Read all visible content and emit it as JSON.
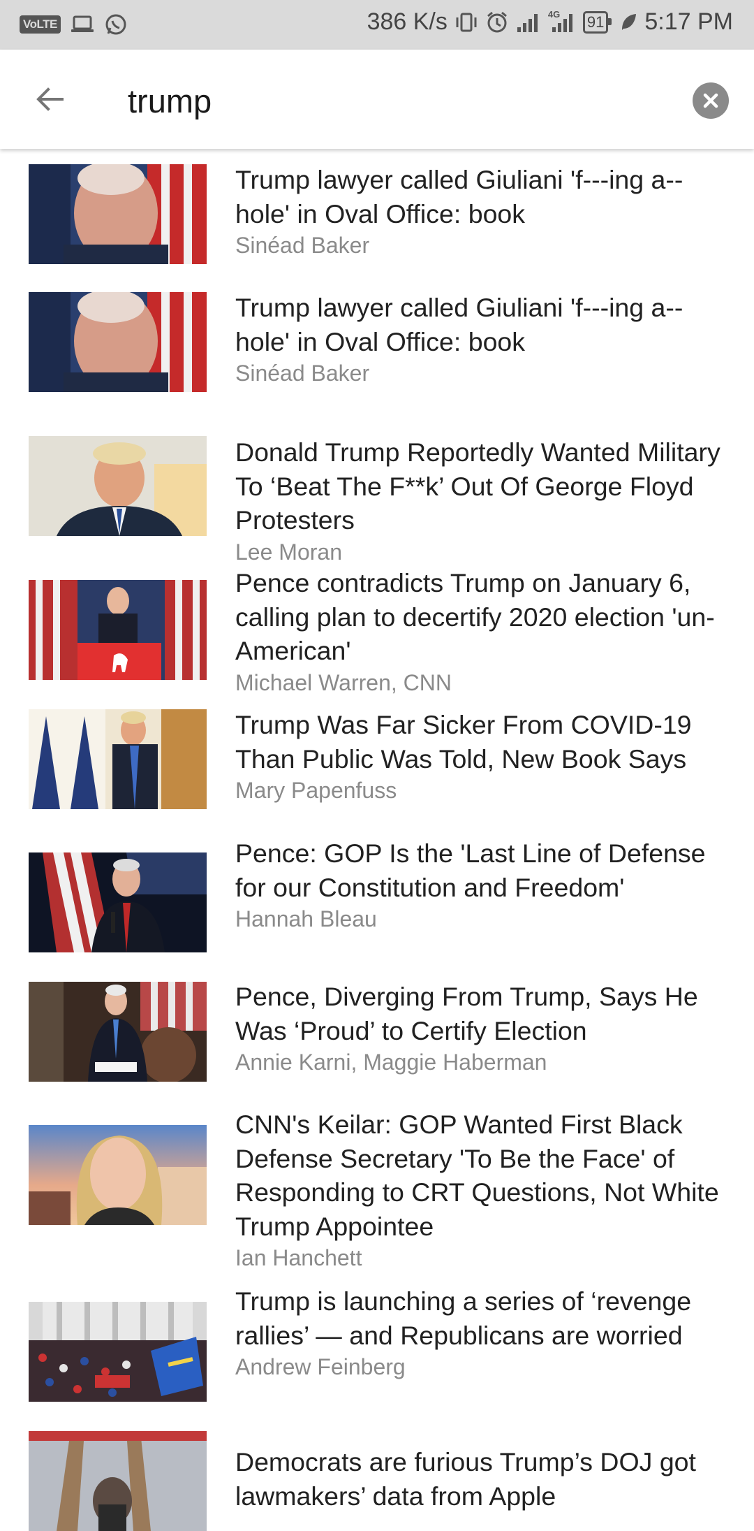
{
  "status_bar": {
    "volte": "VoLTE",
    "net_speed": "386 K/s",
    "network_type": "4G",
    "battery": "91",
    "time": "5:17 PM"
  },
  "search": {
    "query": "trump"
  },
  "results": [
    {
      "title": "Trump lawyer called Giuliani 'f---ing a--hole' in Oval Office: book",
      "author": "Sinéad Baker",
      "thumb_icon": "giuliani-photo"
    },
    {
      "title": "Trump lawyer called Giuliani 'f---ing a--hole' in Oval Office: book",
      "author": "Sinéad Baker",
      "thumb_icon": "giuliani-photo"
    },
    {
      "title": "Donald Trump Reportedly Wanted Military To ‘Beat The F**k’ Out Of George Floyd Protesters",
      "author": "Lee Moran",
      "thumb_icon": "trump-photo"
    },
    {
      "title": "Pence contradicts Trump on January 6, calling plan to decertify 2020 election 'un-American'",
      "author": "Michael Warren, CNN",
      "thumb_icon": "pence-podium-photo"
    },
    {
      "title": "Trump Was Far Sicker From COVID-19 Than Public Was Told, New Book Says",
      "author": "Mary Papenfuss",
      "thumb_icon": "trump-mask-photo"
    },
    {
      "title": "Pence: GOP Is the 'Last Line of Defense for our Constitution and Freedom'",
      "author": "Hannah Bleau",
      "thumb_icon": "pence-mic-photo"
    },
    {
      "title": "Pence, Diverging From Trump, Says He Was ‘Proud’ to Certify Election",
      "author": "Annie Karni, Maggie Haberman",
      "thumb_icon": "pence-senate-photo"
    },
    {
      "title": "CNN's Keilar: GOP Wanted First Black Defense Secretary 'To Be the Face' of Responding to CRT Questions, Not White Trump Appointee",
      "author": "Ian Hanchett",
      "thumb_icon": "keilar-photo"
    },
    {
      "title": "Trump is launching a series of ‘revenge rallies’ — and Republicans are worried",
      "author": "Andrew Feinberg",
      "thumb_icon": "rally-crowd-photo"
    },
    {
      "title": "Democrats are furious Trump’s DOJ got lawmakers’ data from Apple",
      "author": "",
      "thumb_icon": "crowd-photo"
    }
  ]
}
